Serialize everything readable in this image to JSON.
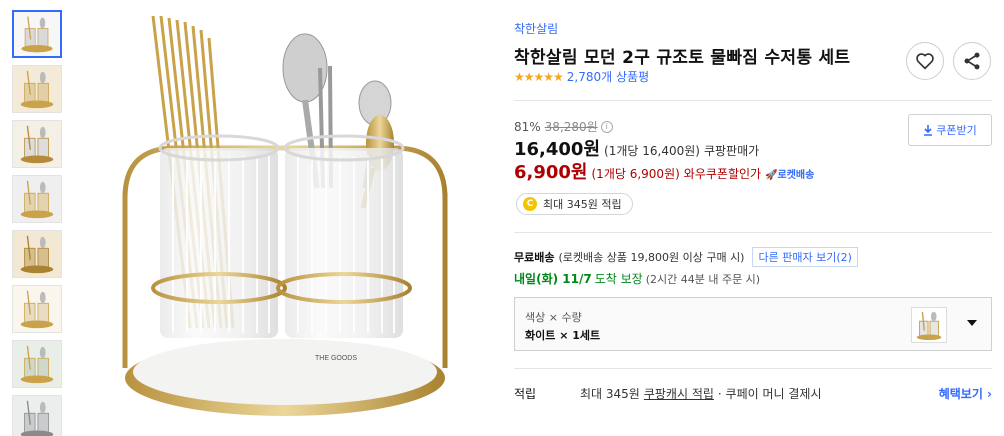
{
  "thumbnails": [
    {
      "alt": "thumb-1",
      "active": true
    },
    {
      "alt": "thumb-2",
      "active": false
    },
    {
      "alt": "thumb-3",
      "active": false
    },
    {
      "alt": "thumb-4",
      "active": false
    },
    {
      "alt": "thumb-5",
      "active": false
    },
    {
      "alt": "thumb-6",
      "active": false
    },
    {
      "alt": "thumb-7",
      "active": false
    },
    {
      "alt": "thumb-8",
      "active": false
    }
  ],
  "main_image": {
    "logo_text": "THE GOODS"
  },
  "product": {
    "brand": "착한살림",
    "title": "착한살림 모던 2구 규조토 물빠짐 수저통 세트",
    "stars": "★★★★★",
    "review_count": "2,780개 상품평"
  },
  "price": {
    "discount_rate": "81%",
    "original_price": "38,280원",
    "info_icon": "i",
    "sale_price": "16,400원",
    "sale_unit": "(1개당 16,400원)",
    "sale_label": "쿠팡판매가",
    "coupon_price": "6,900원",
    "coupon_unit": "(1개당 6,900원)",
    "coupon_label": "와우쿠폰할인가",
    "rocket_label": "🚀로켓배송",
    "coupon_button": "쿠폰받기"
  },
  "points": {
    "coin_symbol": "C",
    "text": "최대 345원 적립"
  },
  "shipping": {
    "label": "무료배송",
    "detail": "(로켓배송 상품 19,800원 이상 구매 시)",
    "other_sellers": "다른 판매자 보기(2)"
  },
  "delivery": {
    "day": "내일(화) 11/7",
    "status": "도착 보장",
    "note": "(2시간 44분 내 주문 시)"
  },
  "option": {
    "names": "색상 × 수량",
    "values": "화이트 × 1세트"
  },
  "reward": {
    "label": "적립",
    "prefix": "최대 345원",
    "link": "쿠팡캐시 적립",
    "suffix": "· 쿠페이 머니 결제시",
    "benefit": "혜택보기 ›"
  },
  "colors": {
    "accent_blue": "#346aff",
    "coupon_red": "#ae0000",
    "delivery_green": "#00891a",
    "star_gold": "#f5a623",
    "product_gold": "#c9a24a"
  }
}
